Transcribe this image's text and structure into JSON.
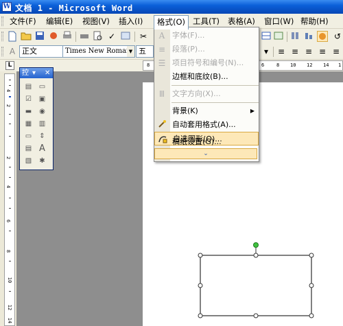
{
  "window": {
    "title": "文档 1 - Microsoft Word"
  },
  "menubar": {
    "items": [
      "文件(F)",
      "编辑(E)",
      "视图(V)",
      "插入(I)",
      "格式(O)",
      "工具(T)",
      "表格(A)",
      "窗口(W)",
      "帮助(H)"
    ],
    "active_index": 4
  },
  "format_toolbar": {
    "style_value": "正文",
    "font_value": "Times New Roman",
    "size_value": "五"
  },
  "dropdown": {
    "items": [
      {
        "label": "字体(F)...",
        "state": "disabled",
        "icon": "font-a-icon"
      },
      {
        "label": "段落(P)...",
        "state": "disabled",
        "icon": "paragraph-icon"
      },
      {
        "label": "项目符号和编号(N)...",
        "state": "disabled",
        "icon": "bullets-icon"
      },
      {
        "label": "边框和底纹(B)...",
        "state": "enabled",
        "icon": ""
      },
      {
        "label": "文字方向(X)...",
        "state": "disabled",
        "icon": "text-direction-icon"
      },
      {
        "label": "背景(K)",
        "state": "enabled",
        "icon": "",
        "submenu": true
      },
      {
        "label": "自动套用格式(A)...",
        "state": "enabled",
        "icon": "autoformat-icon"
      },
      {
        "label": "自选图形(O)...",
        "state": "highlighted",
        "icon": "autoshape-icon"
      },
      {
        "label": "稿纸设置(G)...",
        "state": "enabled",
        "icon": ""
      }
    ],
    "expand_glyph": "⌄"
  },
  "floating_toolbar": {
    "title": "控"
  },
  "ruler": {
    "h_numbers": [
      "8",
      "6",
      "8",
      "10",
      "12",
      "14",
      "1"
    ],
    "v_numbers": [
      "4",
      "2",
      "2",
      "4",
      "6",
      "8",
      "10",
      "12",
      "14"
    ]
  }
}
